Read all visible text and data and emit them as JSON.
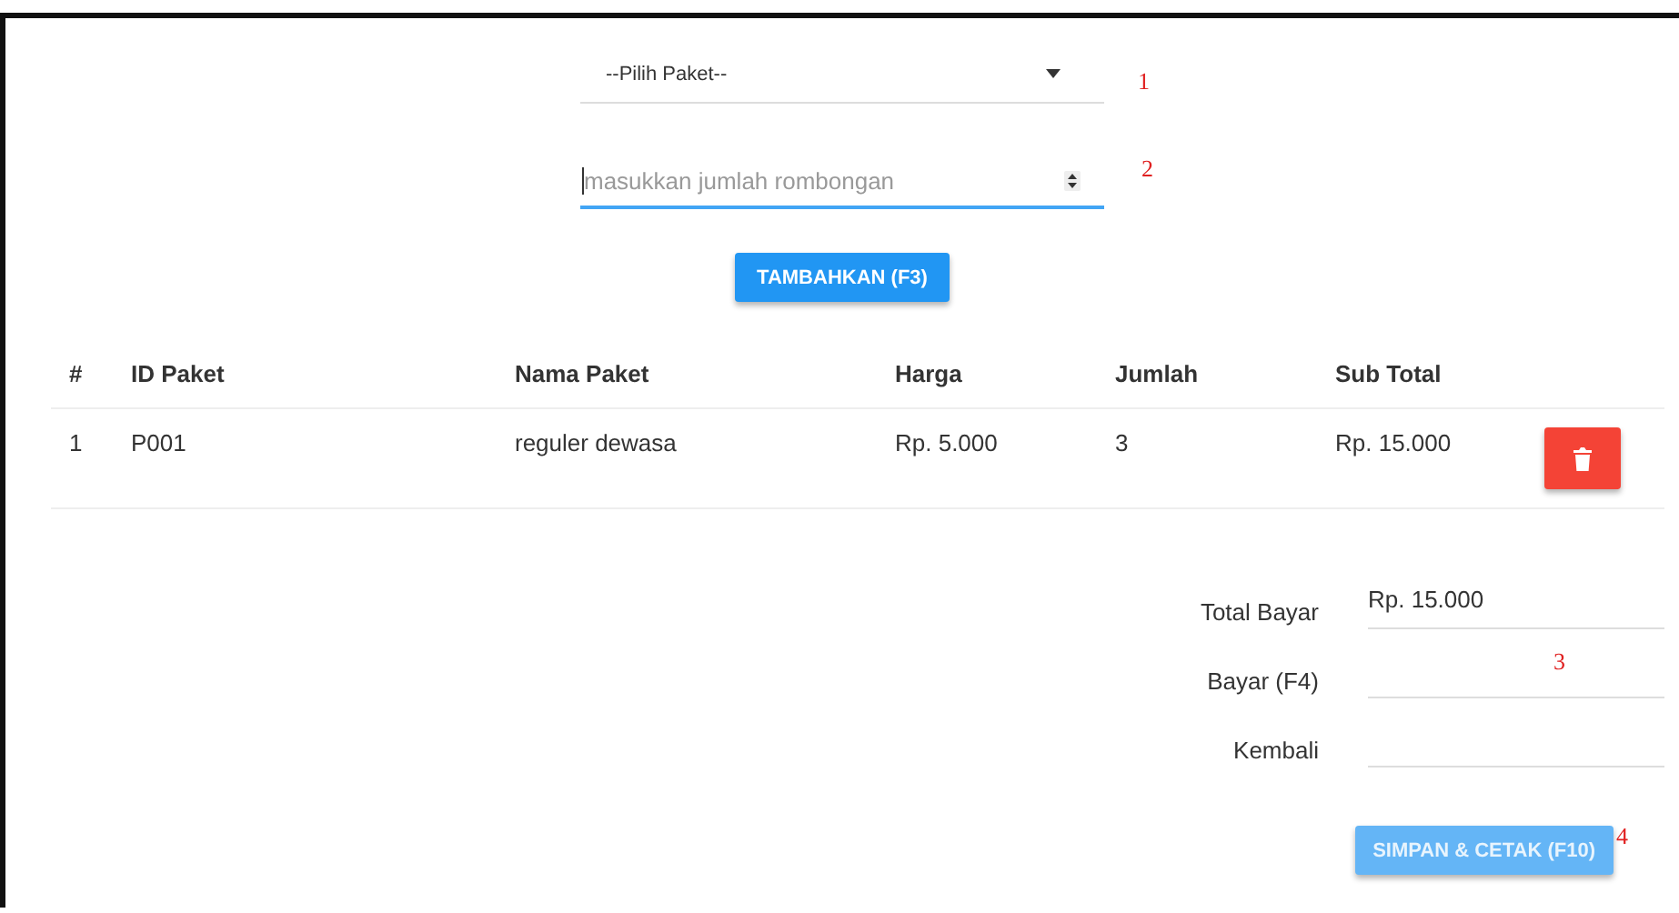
{
  "package_select": {
    "value": "--Pilih Paket--",
    "marker": "1"
  },
  "quantity_field": {
    "placeholder": "masukkan jumlah rombongan",
    "focused": true,
    "marker": "2"
  },
  "add_button": {
    "label": "TAMBAHKAN (F3)"
  },
  "table": {
    "columns": [
      "#",
      "ID Paket",
      "Nama Paket",
      "Harga",
      "Jumlah",
      "Sub Total"
    ],
    "rows": [
      {
        "cells": [
          "1",
          "P001",
          "reguler dewasa",
          "Rp. 5.000",
          "3",
          "Rp. 15.000"
        ]
      }
    ]
  },
  "payment": {
    "marker": "3",
    "fields": [
      {
        "label": "Total Bayar",
        "value": "Rp. 15.000"
      },
      {
        "label": "Bayar (F4)"
      },
      {
        "label": "Kembali"
      }
    ]
  },
  "save_button": {
    "label": "SIMPAN & CETAK (F10)",
    "disabled": true,
    "marker": "4"
  }
}
